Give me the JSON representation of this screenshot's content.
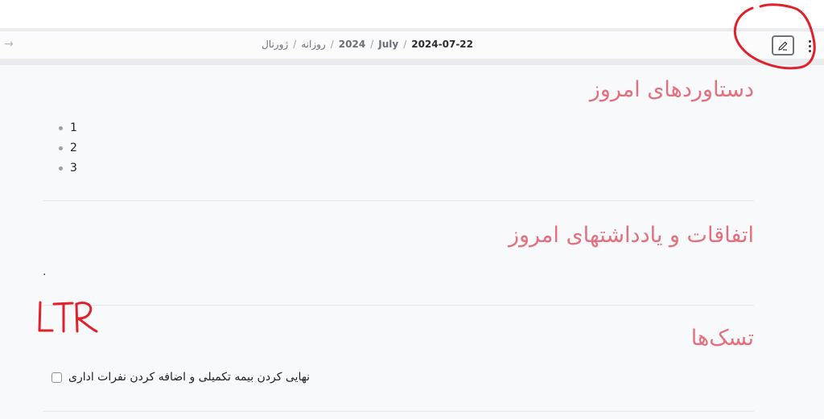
{
  "header": {
    "breadcrumb": {
      "items": [
        "ژورنال",
        "روزانه",
        "2024",
        "July",
        "2024-07-22"
      ],
      "separator": "/"
    },
    "forward_icon": "arrow-right-icon",
    "edit_icon": "pencil-icon",
    "more_icon": "vertical-ellipsis-icon"
  },
  "note": {
    "sections": [
      {
        "title": "دستاوردهای امروز",
        "items": [
          "1",
          "2",
          "3"
        ]
      },
      {
        "title": "اتفاقات و یادداشتهای امروز",
        "text": "."
      },
      {
        "title": "تسک‌ها",
        "tasks": [
          {
            "label": "نهایی کردن بیمه تکمیلی و اضافه کردن نفرات اداری",
            "checked": false
          }
        ]
      }
    ]
  },
  "annotation": {
    "text": "LTR",
    "color": "#e0202a"
  },
  "colors": {
    "heading": "#e3707e",
    "annotation": "#e0202a"
  }
}
